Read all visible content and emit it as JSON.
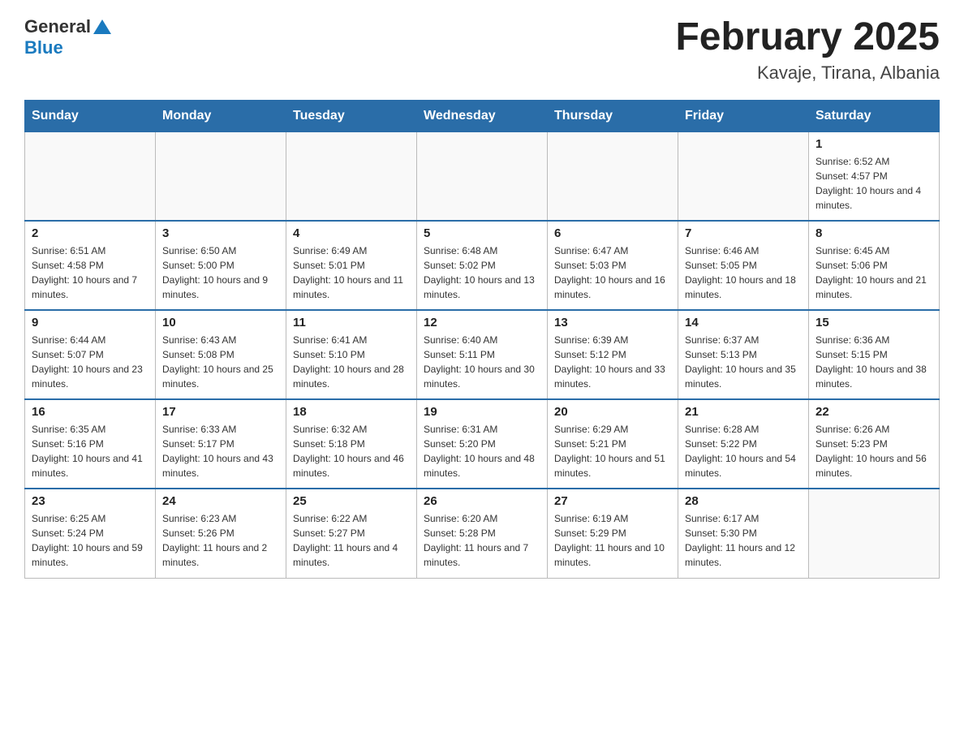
{
  "header": {
    "title": "February 2025",
    "subtitle": "Kavaje, Tirana, Albania",
    "logo_general": "General",
    "logo_blue": "Blue"
  },
  "days_of_week": [
    "Sunday",
    "Monday",
    "Tuesday",
    "Wednesday",
    "Thursday",
    "Friday",
    "Saturday"
  ],
  "weeks": [
    [
      {
        "day": "",
        "info": ""
      },
      {
        "day": "",
        "info": ""
      },
      {
        "day": "",
        "info": ""
      },
      {
        "day": "",
        "info": ""
      },
      {
        "day": "",
        "info": ""
      },
      {
        "day": "",
        "info": ""
      },
      {
        "day": "1",
        "info": "Sunrise: 6:52 AM\nSunset: 4:57 PM\nDaylight: 10 hours and 4 minutes."
      }
    ],
    [
      {
        "day": "2",
        "info": "Sunrise: 6:51 AM\nSunset: 4:58 PM\nDaylight: 10 hours and 7 minutes."
      },
      {
        "day": "3",
        "info": "Sunrise: 6:50 AM\nSunset: 5:00 PM\nDaylight: 10 hours and 9 minutes."
      },
      {
        "day": "4",
        "info": "Sunrise: 6:49 AM\nSunset: 5:01 PM\nDaylight: 10 hours and 11 minutes."
      },
      {
        "day": "5",
        "info": "Sunrise: 6:48 AM\nSunset: 5:02 PM\nDaylight: 10 hours and 13 minutes."
      },
      {
        "day": "6",
        "info": "Sunrise: 6:47 AM\nSunset: 5:03 PM\nDaylight: 10 hours and 16 minutes."
      },
      {
        "day": "7",
        "info": "Sunrise: 6:46 AM\nSunset: 5:05 PM\nDaylight: 10 hours and 18 minutes."
      },
      {
        "day": "8",
        "info": "Sunrise: 6:45 AM\nSunset: 5:06 PM\nDaylight: 10 hours and 21 minutes."
      }
    ],
    [
      {
        "day": "9",
        "info": "Sunrise: 6:44 AM\nSunset: 5:07 PM\nDaylight: 10 hours and 23 minutes."
      },
      {
        "day": "10",
        "info": "Sunrise: 6:43 AM\nSunset: 5:08 PM\nDaylight: 10 hours and 25 minutes."
      },
      {
        "day": "11",
        "info": "Sunrise: 6:41 AM\nSunset: 5:10 PM\nDaylight: 10 hours and 28 minutes."
      },
      {
        "day": "12",
        "info": "Sunrise: 6:40 AM\nSunset: 5:11 PM\nDaylight: 10 hours and 30 minutes."
      },
      {
        "day": "13",
        "info": "Sunrise: 6:39 AM\nSunset: 5:12 PM\nDaylight: 10 hours and 33 minutes."
      },
      {
        "day": "14",
        "info": "Sunrise: 6:37 AM\nSunset: 5:13 PM\nDaylight: 10 hours and 35 minutes."
      },
      {
        "day": "15",
        "info": "Sunrise: 6:36 AM\nSunset: 5:15 PM\nDaylight: 10 hours and 38 minutes."
      }
    ],
    [
      {
        "day": "16",
        "info": "Sunrise: 6:35 AM\nSunset: 5:16 PM\nDaylight: 10 hours and 41 minutes."
      },
      {
        "day": "17",
        "info": "Sunrise: 6:33 AM\nSunset: 5:17 PM\nDaylight: 10 hours and 43 minutes."
      },
      {
        "day": "18",
        "info": "Sunrise: 6:32 AM\nSunset: 5:18 PM\nDaylight: 10 hours and 46 minutes."
      },
      {
        "day": "19",
        "info": "Sunrise: 6:31 AM\nSunset: 5:20 PM\nDaylight: 10 hours and 48 minutes."
      },
      {
        "day": "20",
        "info": "Sunrise: 6:29 AM\nSunset: 5:21 PM\nDaylight: 10 hours and 51 minutes."
      },
      {
        "day": "21",
        "info": "Sunrise: 6:28 AM\nSunset: 5:22 PM\nDaylight: 10 hours and 54 minutes."
      },
      {
        "day": "22",
        "info": "Sunrise: 6:26 AM\nSunset: 5:23 PM\nDaylight: 10 hours and 56 minutes."
      }
    ],
    [
      {
        "day": "23",
        "info": "Sunrise: 6:25 AM\nSunset: 5:24 PM\nDaylight: 10 hours and 59 minutes."
      },
      {
        "day": "24",
        "info": "Sunrise: 6:23 AM\nSunset: 5:26 PM\nDaylight: 11 hours and 2 minutes."
      },
      {
        "day": "25",
        "info": "Sunrise: 6:22 AM\nSunset: 5:27 PM\nDaylight: 11 hours and 4 minutes."
      },
      {
        "day": "26",
        "info": "Sunrise: 6:20 AM\nSunset: 5:28 PM\nDaylight: 11 hours and 7 minutes."
      },
      {
        "day": "27",
        "info": "Sunrise: 6:19 AM\nSunset: 5:29 PM\nDaylight: 11 hours and 10 minutes."
      },
      {
        "day": "28",
        "info": "Sunrise: 6:17 AM\nSunset: 5:30 PM\nDaylight: 11 hours and 12 minutes."
      },
      {
        "day": "",
        "info": ""
      }
    ]
  ]
}
